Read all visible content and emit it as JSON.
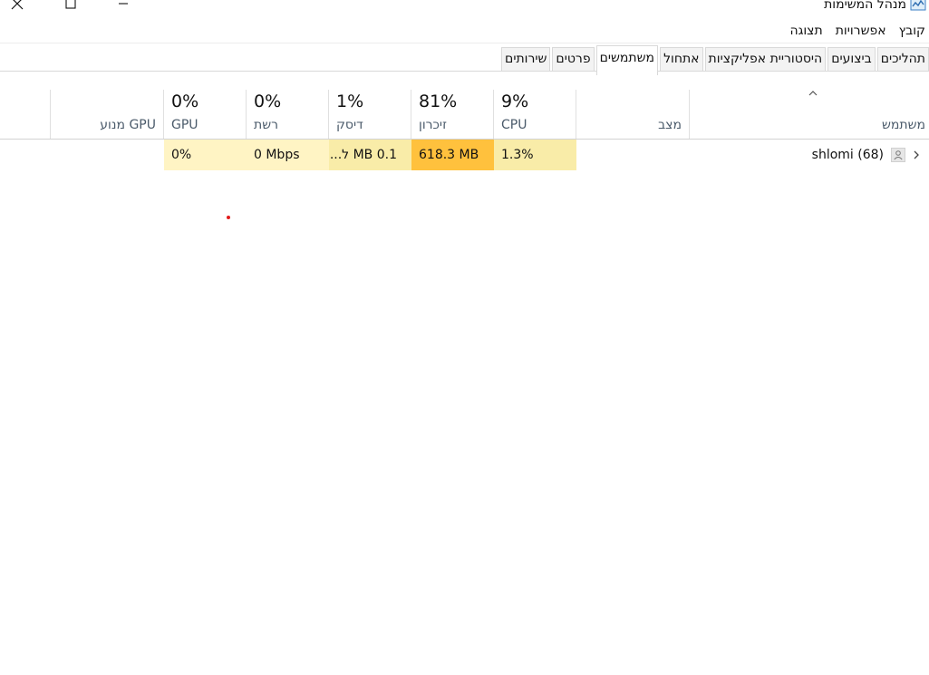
{
  "window": {
    "title": "מנהל המשימות"
  },
  "menu": [
    "קובץ",
    "אפשרויות",
    "תצוגה"
  ],
  "tabs": [
    {
      "label": "תהליכים",
      "active": false
    },
    {
      "label": "ביצועים",
      "active": false
    },
    {
      "label": "היסטוריית אפליקציות",
      "active": false
    },
    {
      "label": "אתחול",
      "active": false
    },
    {
      "label": "משתמשים",
      "active": true
    },
    {
      "label": "פרטים",
      "active": false
    },
    {
      "label": "שירותים",
      "active": false
    }
  ],
  "columns": {
    "user": {
      "label": "משתמש"
    },
    "status": {
      "label": "מצב"
    },
    "cpu": {
      "label": "CPU",
      "percent": "9%"
    },
    "memory": {
      "label": "זיכרון",
      "percent": "81%"
    },
    "disk": {
      "label": "דיסק",
      "percent": "1%"
    },
    "network": {
      "label": "רשת",
      "percent": "0%"
    },
    "gpu": {
      "label": "GPU",
      "percent": "0%"
    },
    "gpu_engine": {
      "label": "מנוע GPU"
    }
  },
  "rows": [
    {
      "user": "shlomi (68)",
      "status": "",
      "cpu": "1.3%",
      "memory": "618.3 MB",
      "disk": "0.1 MB ל...",
      "network": "0 Mbps",
      "gpu": "0%",
      "gpu_engine": ""
    }
  ],
  "colors": {
    "heat_light": "#fff4c4",
    "heat_medium": "#f9eca8",
    "heat_high": "#ffc13d"
  },
  "icons": {
    "close": "close-icon",
    "maximize": "maximize-icon",
    "minimize": "minimize-icon",
    "app": "task-manager-icon",
    "sort": "sort-up-icon",
    "expand": "chevron-right-icon",
    "user": "user-icon"
  }
}
